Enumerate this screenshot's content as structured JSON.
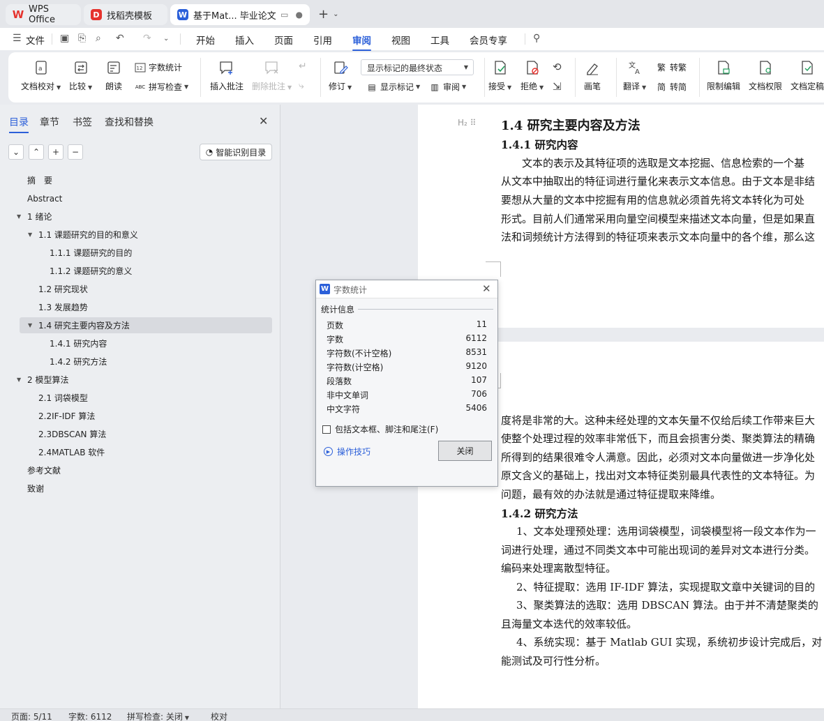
{
  "tabs": {
    "wps": "WPS Office",
    "template": "找稻壳模板",
    "doc": "基于Mat... 毕业论文"
  },
  "menu": {
    "file": "文件",
    "items": [
      "开始",
      "插入",
      "页面",
      "引用",
      "审阅",
      "视图",
      "工具",
      "会员专享"
    ],
    "active": "审阅"
  },
  "ribbon": {
    "doc_proof": "文档校对",
    "compare": "比较",
    "read_aloud": "朗读",
    "word_count": "字数统计",
    "spell_check": "拼写检查",
    "insert_comment": "插入批注",
    "delete_comment": "删除批注",
    "track_changes": "修订",
    "markup_mode": "显示标记的最终状态",
    "show_markup": "显示标记",
    "review": "审阅",
    "accept": "接受",
    "reject": "拒绝",
    "pen": "画笔",
    "translate": "翻译",
    "to_traditional": "转繁",
    "to_simplified": "转简",
    "restrict_edit": "限制编辑",
    "doc_permission": "文档权限",
    "doc_finalize": "文档定稿"
  },
  "nav": {
    "tabs": [
      "目录",
      "章节",
      "书签",
      "查找和替换"
    ],
    "active_tab": "目录",
    "smart_toc": "智能识别目录",
    "toc": [
      {
        "label": "摘　要",
        "level": 0
      },
      {
        "label": "Abstract",
        "level": 0
      },
      {
        "label": "1 绪论",
        "level": 0
      },
      {
        "label": "1.1 课题研究的目的和意义",
        "level": 1
      },
      {
        "label": "1.1.1 课题研究的目的",
        "level": 2
      },
      {
        "label": "1.1.2 课题研究的意义",
        "level": 2
      },
      {
        "label": "1.2 研究现状",
        "level": 1
      },
      {
        "label": "1.3 发展趋势",
        "level": 1
      },
      {
        "label": "1.4 研究主要内容及方法",
        "level": 1
      },
      {
        "label": "1.4.1 研究内容",
        "level": 2
      },
      {
        "label": "1.4.2 研究方法",
        "level": 2
      },
      {
        "label": "2 模型算法",
        "level": 0
      },
      {
        "label": "2.1 词袋模型",
        "level": 1
      },
      {
        "label": "2.2IF-IDF 算法",
        "level": 1
      },
      {
        "label": "2.3DBSCAN 算法",
        "level": 1
      },
      {
        "label": "2.4MATLAB 软件",
        "level": 1
      },
      {
        "label": "参考文献",
        "level": 0
      },
      {
        "label": "致谢",
        "level": 0
      }
    ]
  },
  "document": {
    "page1": [
      "1.4 研究主要内容及方法",
      "1.4.1 研究内容",
      "文本的表示及其特征项的选取是文本挖掘、信息检索的一个基",
      "从文本中抽取出的特征词进行量化来表示文本信息。由于文本是非结",
      "要想从大量的文本中挖掘有用的信息就必须首先将文本转化为可处",
      "形式。目前人们通常采用向量空间模型来描述文本向量，但是如果直",
      "法和词频统计方法得到的特征项来表示文本向量中的各个维，那么这"
    ],
    "page2": [
      "度将是非常的大。这种未经处理的文本矢量不仅给后续工作带来巨大",
      "使整个处理过程的效率非常低下，而且会损害分类、聚类算法的精确",
      "所得到的结果很难令人满意。因此，必须对文本向量做进一步净化处",
      "原文含义的基础上，找出对文本特征类别最具代表性的文本特征。为",
      "问题，最有效的办法就是通过特征提取来降维。",
      "1.4.2 研究方法",
      "1、文本处理预处理：选用词袋模型，词袋模型将一段文本作为一",
      "词进行处理，通过不同类文本中可能出现词的差异对文本进行分类。",
      "编码来处理离散型特征。",
      "2、特征提取：选用 IF-IDF 算法，实现提取文章中关键词的目的",
      "3、聚类算法的选取：选用 DBSCAN 算法。由于并不清楚聚类的",
      "且海量文本迭代的效率较低。",
      "4、系统实现：基于 Matlab GUI 实现，系统初步设计完成后，对",
      "能测试及可行性分析。"
    ]
  },
  "dialog": {
    "title": "字数统计",
    "section": "统计信息",
    "rows": [
      {
        "label": "页数",
        "value": "11"
      },
      {
        "label": "字数",
        "value": "6112"
      },
      {
        "label": "字符数(不计空格)",
        "value": "8531"
      },
      {
        "label": "字符数(计空格)",
        "value": "9120"
      },
      {
        "label": "段落数",
        "value": "107"
      },
      {
        "label": "非中文单词",
        "value": "706"
      },
      {
        "label": "中文字符",
        "value": "5406"
      }
    ],
    "include_label": "包括文本框、脚注和尾注(F)",
    "tips": "操作技巧",
    "close": "关闭"
  },
  "status": {
    "page": "页面: 5/11",
    "words": "字数: 6112",
    "spell": "拼写检查: 关闭",
    "proof": "校对"
  }
}
